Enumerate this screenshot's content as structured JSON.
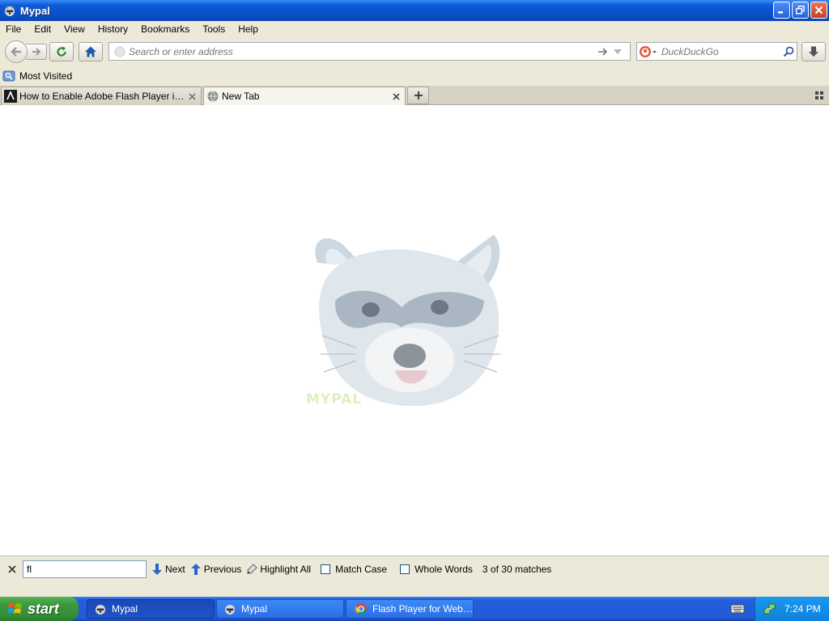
{
  "window": {
    "title": "Mypal",
    "minimize_icon": "minimize-icon",
    "maximize_icon": "restore-icon",
    "close_icon": "close-icon"
  },
  "menu": [
    "File",
    "Edit",
    "View",
    "History",
    "Bookmarks",
    "Tools",
    "Help"
  ],
  "navbar": {
    "url_placeholder": "Search or enter address",
    "url_value": "",
    "search_engine": "DuckDuckGo",
    "search_placeholder": "DuckDuckGo",
    "icons": [
      "back-arrow-icon",
      "forward-arrow-icon",
      "reload-icon",
      "home-icon",
      "go-arrow-icon",
      "dropdown-icon",
      "search-icon",
      "download-icon"
    ]
  },
  "bookmarks": {
    "items": [
      {
        "label": "Most Visited",
        "icon": "bookmark-folder-icon"
      }
    ]
  },
  "tabs": [
    {
      "label": "How to Enable Adobe Flash Player in Goo...",
      "selected": false,
      "icon": "site-favicon-icon"
    },
    {
      "label": "New Tab",
      "selected": true,
      "icon": "globe-icon"
    }
  ],
  "content": {
    "watermark": "MYPAL"
  },
  "findbar": {
    "query": "fl",
    "next_label": "Next",
    "previous_label": "Previous",
    "highlight_all_label": "Highlight All",
    "match_case_label": "Match Case",
    "whole_words_label": "Whole Words",
    "status": "3 of 30 matches",
    "match_case_checked": false,
    "whole_words_checked": false
  },
  "taskbar": {
    "start_label": "start",
    "tasks": [
      {
        "label": "Mypal",
        "active": true,
        "icon": "raccoon-icon"
      },
      {
        "label": "Mypal",
        "active": false,
        "icon": "raccoon-icon"
      },
      {
        "label": "Flash Player for Web ...",
        "active": false,
        "icon": "chrome-icon"
      }
    ],
    "clock": "7:24 PM"
  },
  "colors": {
    "titlebar": "#0a4fc8",
    "chrome": "#ece9d8",
    "start": "#3c9a3d",
    "taskbar": "#245edb",
    "tray": "#0f81dc"
  }
}
